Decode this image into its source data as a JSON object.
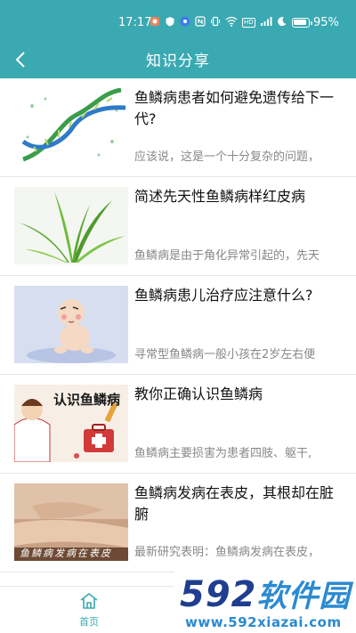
{
  "status_bar": {
    "time": "17:17",
    "icons": [
      "notification-icon",
      "shield-icon",
      "app-icon",
      "nfc-icon",
      "vibrate-icon",
      "wifi-icon",
      "hd-icon",
      "signal-icon",
      "moon-icon"
    ],
    "hd_text": "HD",
    "battery_level": 0.95,
    "battery_text": "95%"
  },
  "nav": {
    "title": "知识分享"
  },
  "articles": [
    {
      "title": "鱼鳞病患者如何避免遗传给下一代?",
      "summary": "应该说，这是一个十分复杂的问题，",
      "image": "dna-helix-image"
    },
    {
      "title": "简述先天性鱼鳞病样红皮病",
      "summary": "鱼鳞病是由于角化异常引起的，先天",
      "image": "grass-image"
    },
    {
      "title": "鱼鳞病患儿治疗应注意什么?",
      "summary": "寻常型鱼鳞病一般小孩在2岁左右便",
      "image": "baby-cartoon-image"
    },
    {
      "title": "教你正确认识鱼鳞病",
      "summary": "鱼鳞病主要损害为患者四肢、躯干,",
      "image": "doctor-cartoon-image",
      "image_text": "认识鱼鳞病"
    },
    {
      "title": "鱼鳞病发病在表皮，其根却在脏腑",
      "summary": "最新研究表明：鱼鳞病发病在表皮，",
      "image": "skin-photo-image",
      "image_text": "鱼鳞病发病在表皮"
    }
  ],
  "tab_bar": {
    "home_label": "首页"
  },
  "watermark": {
    "digits": "592",
    "cn": "软件园",
    "url": "www.592xiazai.com"
  },
  "colors": {
    "primary": "#3aa9b2",
    "summary": "#888888",
    "watermark_dark": "#1f3e8f",
    "watermark_light": "#2b8ad1"
  }
}
